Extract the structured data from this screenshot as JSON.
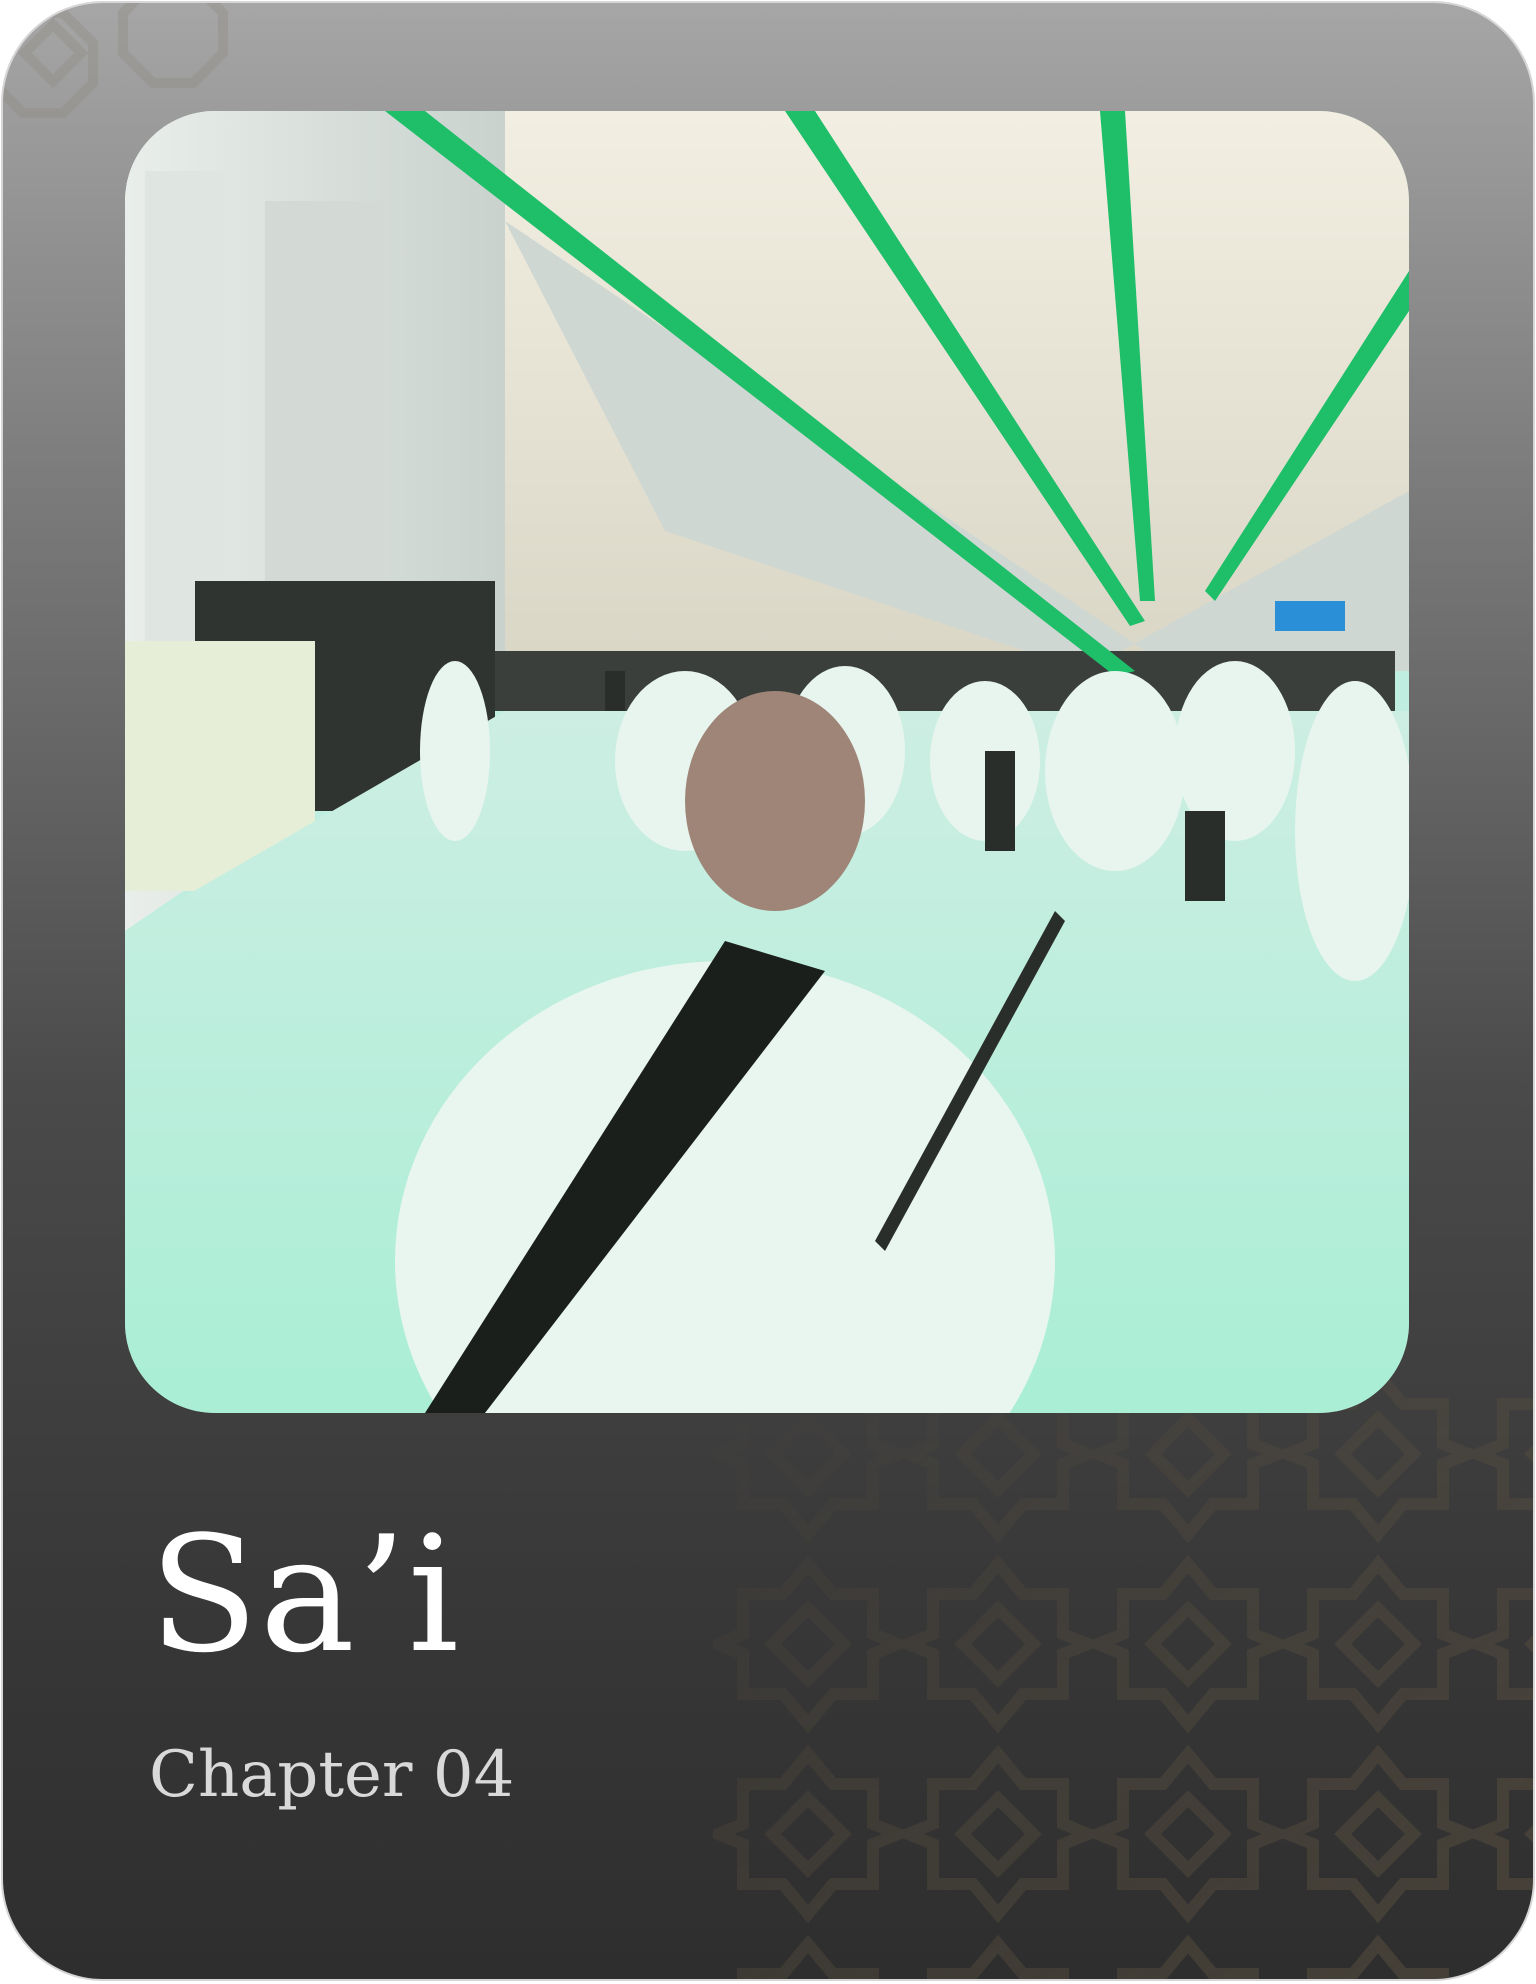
{
  "chapter_card": {
    "title": "Sa’i",
    "subtitle": "Chapter 04",
    "photo_icon": "photo-sai-walkway",
    "pattern_icon": "islamic-star-pattern"
  },
  "colors": {
    "card_top": "#a6a6a6",
    "card_bottom": "#2e2e2e",
    "title": "#ffffff",
    "subtitle": "#d9d9d9",
    "pattern": "#5a5040",
    "accent_green": "#1fbf6a",
    "photo_tint": "#bfeee0"
  }
}
